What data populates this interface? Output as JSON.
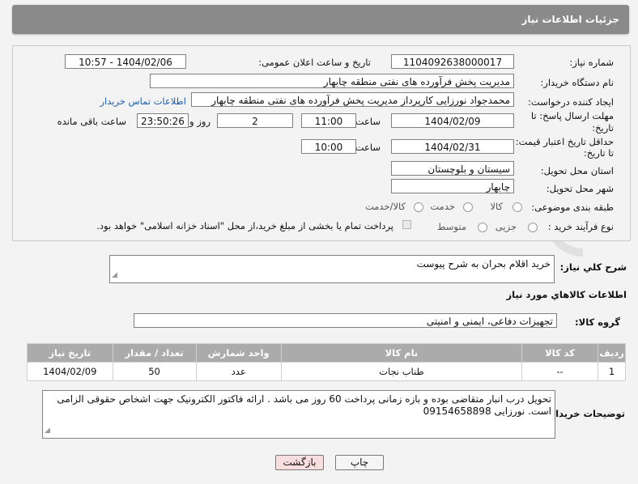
{
  "header": {
    "title": "جزئیات اطلاعات نیاز"
  },
  "form": {
    "need_number_label": "شماره نیاز:",
    "need_number": "1104092638000017",
    "announce_label": "تاریخ و ساعت اعلان عمومی:",
    "announce_value": "1404/02/06 - 10:57",
    "buyer_org_label": "نام دستگاه خریدار:",
    "buyer_org": "مدیریت پخش فرآورده های نفتی منطقه چابهار",
    "creator_label": "ایجاد کننده درخواست:",
    "creator": "محمدجواد نورزایی کارپرداز مدیریت پخش فرآورده های نفتی منطقه چابهار",
    "contact_link": "اطلاعات تماس خریدار",
    "deadline_label_1": "مهلت ارسال پاسخ: تا",
    "deadline_label_2": "تاریخ:",
    "deadline_date": "1404/02/09",
    "time_label": "ساعت",
    "deadline_time": "11:00",
    "days_value": "2",
    "days_label": "روز و",
    "remaining_value": "23:50:26",
    "remaining_label": "ساعت باقی مانده",
    "validity_label_1": "حداقل تاریخ اعتبار قیمت:",
    "validity_label_2": "تا تاریخ:",
    "validity_date": "1404/02/31",
    "validity_time": "10:00",
    "province_label": "استان محل تحویل:",
    "province": "سیستان و بلوچستان",
    "city_label": "شهر محل تحویل:",
    "city": "چابهار",
    "category_label": "طبقه بندی موضوعی:",
    "category_options": [
      "کالا",
      "خدمت",
      "کالا/خدمت"
    ],
    "process_label": "نوع فرآیند خرید :",
    "process_options": [
      "جزیی",
      "متوسط"
    ],
    "payment_note": "پرداخت تمام یا بخشی از مبلغ خرید،از محل \"اسناد خزانه اسلامی\" خواهد بود."
  },
  "summary": {
    "label": "شرح کلي نياز:",
    "value": "خرید اقلام بحران به شرح پیوست"
  },
  "goods": {
    "section_title": "اطلاعات کالاهاي مورد نياز",
    "group_label": "گروه کالا:",
    "group_value": "تجهیزات دفاعی، ایمنی و امنیتی",
    "columns": [
      "ردیف",
      "کد کالا",
      "نام کالا",
      "واحد شمارش",
      "تعداد / مقدار",
      "تاریخ نیاز"
    ],
    "rows": [
      [
        "1",
        "--",
        "طناب نجات",
        "عدد",
        "50",
        "1404/02/09"
      ]
    ]
  },
  "buyer_notes": {
    "label": "توضیحات خریدار:",
    "value": "تحویل درب انبار متقاضی بوده و بازه زمانی پرداخت 60 روز می باشد . ارائه فاکتور الکترونیک جهت اشخاص حقوقی الزامی است. نورزایی 09154658898"
  },
  "buttons": {
    "print": "چاپ",
    "back": "بازگشت"
  },
  "watermark": {
    "text": "AriaTender.net"
  },
  "colors": {
    "header_bg": "#8a8a8a",
    "table_header_bg": "#ababab",
    "link": "#1a5fb4",
    "back_button_bg": "#f8dede"
  }
}
